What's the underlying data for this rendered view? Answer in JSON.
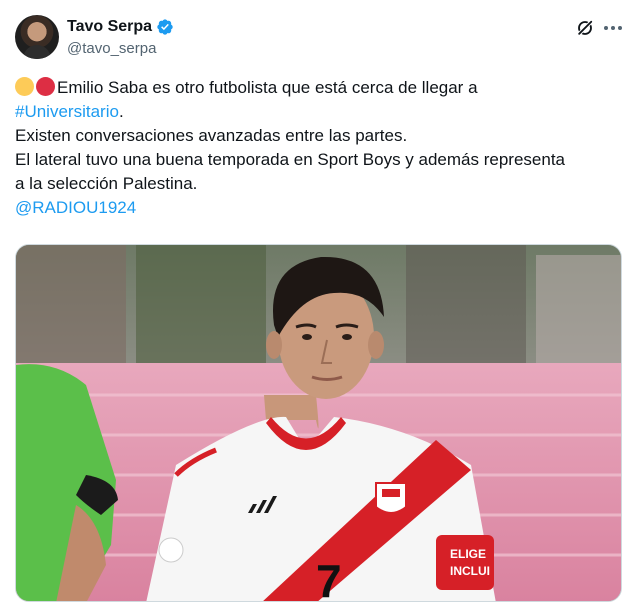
{
  "author": {
    "display_name": "Tavo Serpa",
    "handle": "@tavo_serpa",
    "verified": true
  },
  "tweet": {
    "emoji": [
      "yellow-circle",
      "red-circle"
    ],
    "line1": "Emilio Saba es otro futbolista que está cerca de llegar a",
    "hashtag": "#Universitario",
    "hashtag_suffix": ".",
    "line2": "Existen conversaciones avanzadas entre las partes.",
    "line3": "El lateral tuvo una buena temporada en Sport Boys y además representa",
    "line4": "a la selección Palestina.",
    "mention": "@RADIOU1924"
  },
  "media": {
    "armband_line1": "ELIGE",
    "armband_line2": "INCLUI",
    "shirt_number": "7"
  },
  "colors": {
    "link": "#1d9bf0",
    "verified": "#1d9bf0",
    "secondary_text": "#536471"
  },
  "icons": {
    "grok": "grok-icon",
    "more": "more-icon"
  }
}
